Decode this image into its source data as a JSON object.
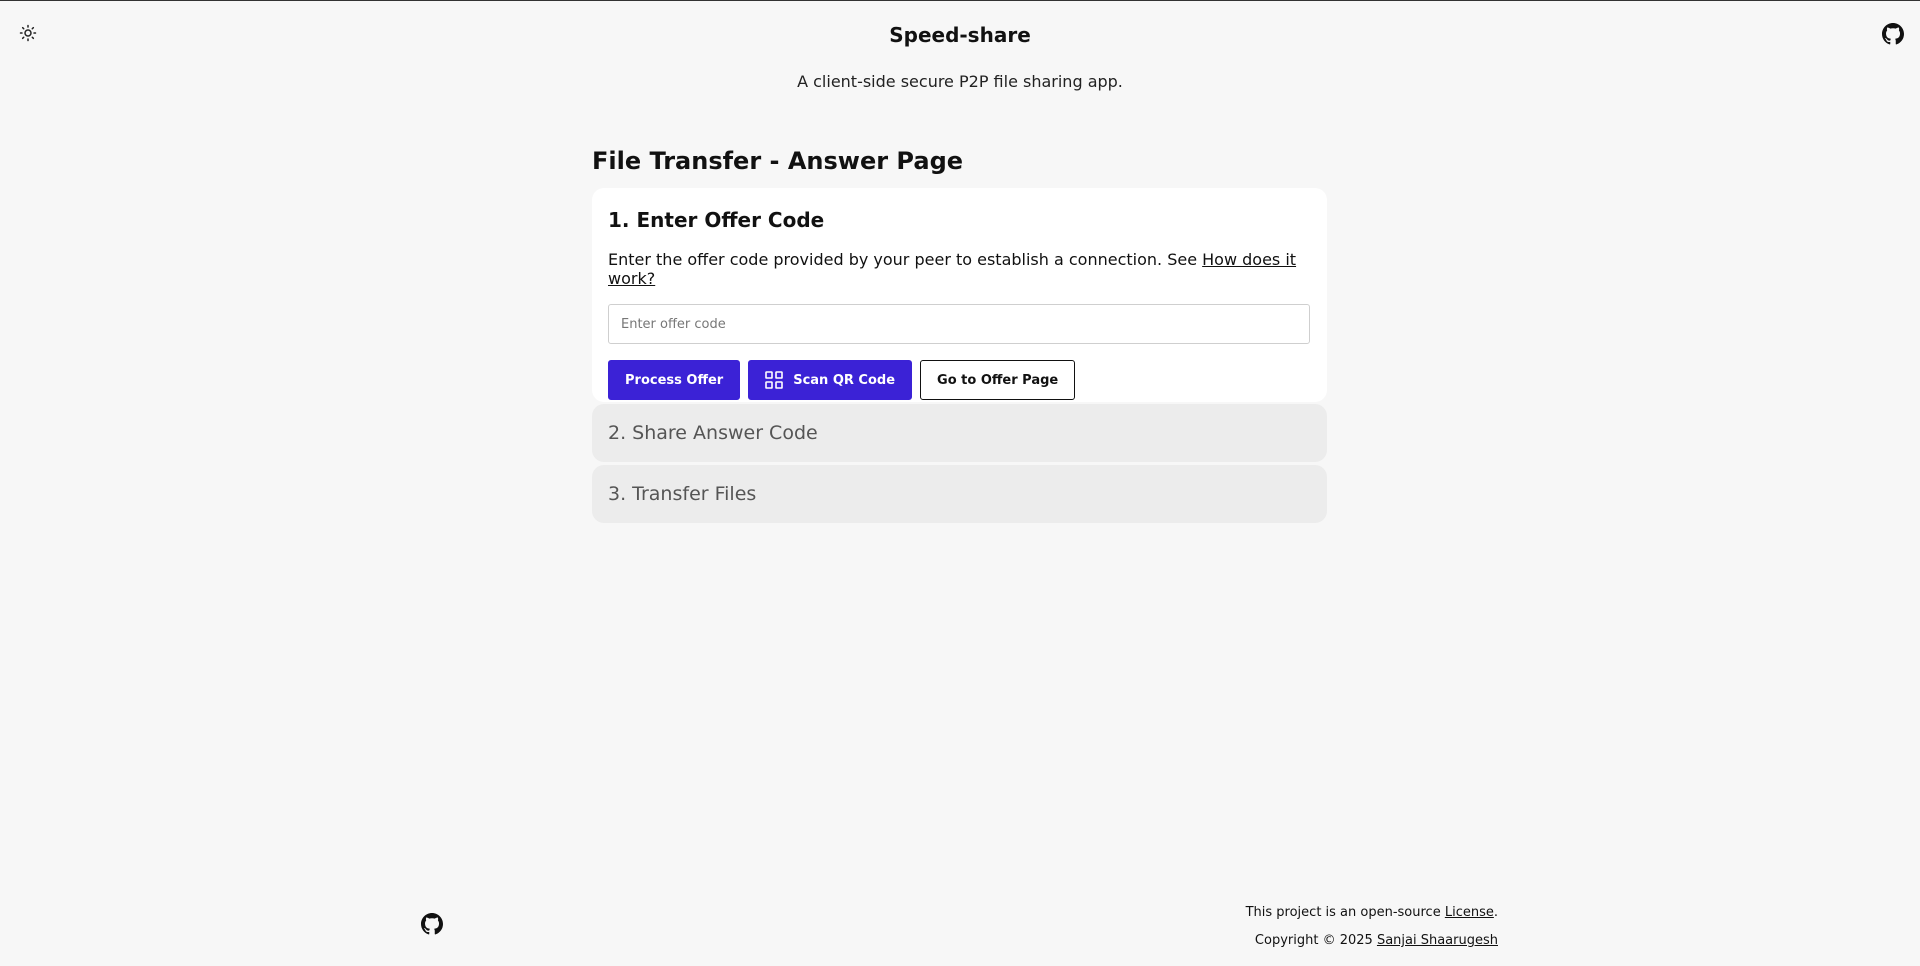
{
  "header": {
    "theme_icon": "sun-icon",
    "github_icon": "github-icon",
    "title": "Speed-share",
    "subtitle": "A client-side secure P2P file sharing app."
  },
  "main": {
    "page_title": "File Transfer - Answer Page",
    "step1": {
      "title": "1. Enter Offer Code",
      "description": "Enter the offer code provided by your peer to establish a connection. See ",
      "link": "How does it work?",
      "input_placeholder": "Enter offer code",
      "input_value": "",
      "buttons": {
        "process": "Process Offer",
        "scan": "Scan QR Code",
        "scan_icon": "qr-grid-icon",
        "offer_page": "Go to Offer Page"
      }
    },
    "step2": {
      "title": "2. Share Answer Code"
    },
    "step3": {
      "title": "3. Transfer Files"
    }
  },
  "footer": {
    "github_icon": "github-icon",
    "license_prefix": "This project is an open-source ",
    "license_link": "License",
    "license_suffix": ".",
    "copyright_prefix": "Copyright © 2025 ",
    "author_link": "Sanjai Shaarugesh"
  },
  "colors": {
    "background": "#f7f7f7",
    "primary_button": "#3b22d6",
    "card": "#ffffff",
    "collapsed_step": "#ececec"
  }
}
